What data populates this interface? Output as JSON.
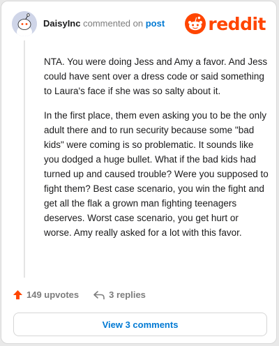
{
  "comment": {
    "username": "DaisyInc",
    "action_text": "commented on",
    "target_link": "post",
    "paragraphs": [
      "NTA. You were doing Jess and Amy a favor. And Jess could have sent over a dress code or said something to Laura's face if she was so salty about it.",
      "In the first place, them even asking you to be the only adult there and to run security because some \"bad kids\" were coming is so problematic. It sounds like you dodged a huge bullet. What if the bad kids had turned up and caused trouble? Were you supposed to fight them? Best case scenario, you win the fight and get all the flak a grown man fighting teenagers deserves. Worst case scenario, you get hurt or worse. Amy really asked for a lot with this favor."
    ],
    "upvotes_label": "149 upvotes",
    "replies_label": "3 replies",
    "view_comments_label": "View 3 comments"
  },
  "brand": {
    "name": "reddit",
    "logo_icon": "reddit-alien-icon",
    "color": "#ff4500"
  },
  "colors": {
    "upvote": "#ff4500",
    "link": "#0079d3"
  }
}
